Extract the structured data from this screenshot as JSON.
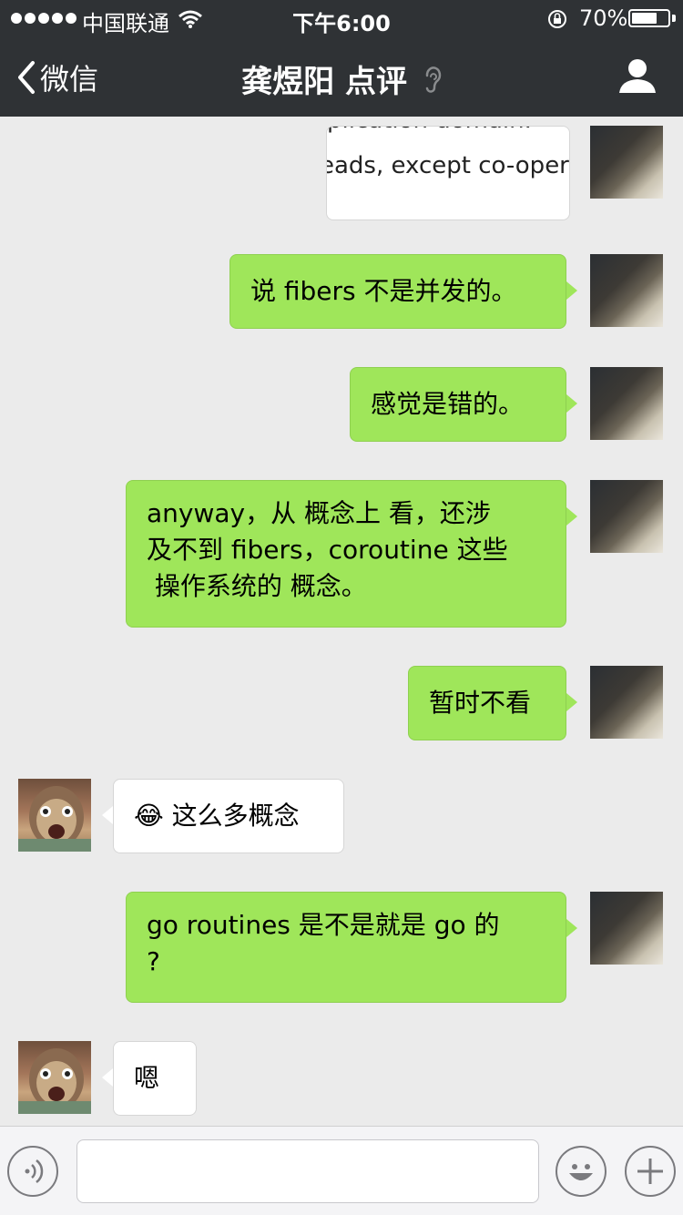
{
  "status_bar": {
    "carrier": "中国联通",
    "time": "下午6:00",
    "battery_percent": "70%",
    "battery_level": 0.7
  },
  "nav": {
    "back_label": "微信",
    "title": "龚煜阳 点评"
  },
  "partial_message": {
    "line1": "plication domain.",
    "line2": "eads, except co-opera"
  },
  "messages": [
    {
      "side": "right",
      "text": "说 fibers 不是并发的。"
    },
    {
      "side": "right",
      "text": "感觉是错的。"
    },
    {
      "side": "right",
      "text_lines": [
        "anyway，从 概念上 看，还涉",
        "及不到 fibers，coroutine 这些",
        " 操作系统的 概念。"
      ]
    },
    {
      "side": "right",
      "text": "暂时不看"
    },
    {
      "side": "left",
      "emoji": "😂",
      "text": "这么多概念"
    },
    {
      "side": "right",
      "text_lines": [
        "go routines 是不是就是 go 的",
        "?"
      ]
    },
    {
      "side": "left",
      "text": "嗯"
    }
  ],
  "icons": {
    "back": "chevron-left-icon",
    "ear": "ear-icon",
    "profile": "person-icon",
    "voice": "voice-icon",
    "emoji": "smiley-icon",
    "plus": "plus-icon"
  },
  "colors": {
    "nav_bg": "#2f3235",
    "chat_bg": "#ebebeb",
    "bubble_green": "#9fe65a",
    "bubble_white": "#ffffff"
  }
}
